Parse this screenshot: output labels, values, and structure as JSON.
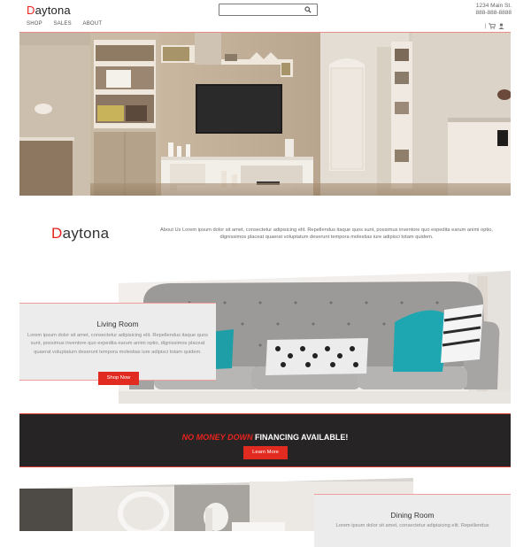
{
  "header": {
    "logo_first": "D",
    "logo_rest": "aytona",
    "search": {
      "placeholder": ""
    },
    "address_line": "1234 Main St.",
    "phone": "888-888-8888",
    "nav": [
      "SHOP",
      "SALES",
      "ABOUT"
    ],
    "utils_separator": "|"
  },
  "about": {
    "logo_first": "D",
    "logo_rest": "aytona",
    "text": "About Us Lorem ipsum dolor sit amet, consectetur adipisicing elit. Repellendus itaque quos sunt, possimus inventore quo expedita earum animi optio, dignissimos placeat quaerat voluptatum deserunt tempora molestias iure adipisci totam quidem."
  },
  "living_room": {
    "title": "Living Room",
    "text": "Lorem ipsum dolor sit amet, consectetur adipisicing elit. Repellendus itaque quos sunt, possimus inventore quo expedita earum animi optio, dignissimos placeat quaerat voluptatum deserunt tempora molestias iure adipisci totam quidem.",
    "button": "Shop Now"
  },
  "financing": {
    "highlight": "NO MONEY DOWN",
    "rest": " FINANCING AVAILABLE!",
    "button": "Learn More"
  },
  "dining_room": {
    "title": "Dining Room",
    "text": "Lorem ipsum dolor sit amet, consectetur adipisicing elit. Repellendus"
  },
  "colors": {
    "accent": "#e12b20",
    "banner_bg": "#262425",
    "card_bg": "#ececec"
  },
  "icons": [
    "search-icon",
    "cart-icon",
    "user-icon"
  ]
}
